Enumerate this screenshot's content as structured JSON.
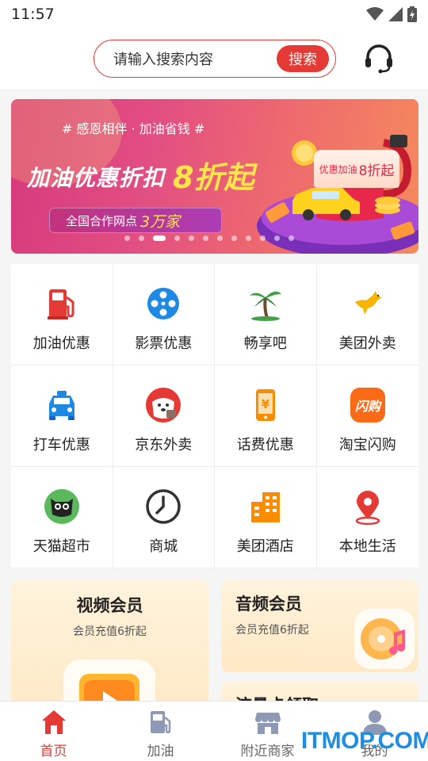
{
  "status": {
    "time": "11:57"
  },
  "search": {
    "placeholder": "请输入搜索内容",
    "button": "搜索"
  },
  "header": {
    "support_icon": "headset-icon"
  },
  "banner": {
    "tagline": "# 感恩相伴 · 加油省钱 #",
    "headline": "加油优惠折扣",
    "discount": "8折起",
    "pill_text": "全国合作网点",
    "pill_number": "3万家",
    "sign_text": "优惠加油",
    "sign_big": "8折起",
    "dots_total": 12,
    "dots_active": 2
  },
  "grid": {
    "items": [
      {
        "label": "加油优惠",
        "icon": "fuel-pump-icon",
        "color": "#e53935"
      },
      {
        "label": "影票优惠",
        "icon": "film-reel-icon",
        "color": "#1e88e5"
      },
      {
        "label": "畅享吧",
        "icon": "palm-tree-icon",
        "color": "#43a047"
      },
      {
        "label": "美团外卖",
        "icon": "kangaroo-icon",
        "color": "#f7b500"
      },
      {
        "label": "打车优惠",
        "icon": "taxi-icon",
        "color": "#1e88e5"
      },
      {
        "label": "京东外卖",
        "icon": "jd-dog-icon",
        "color": "#e53935"
      },
      {
        "label": "话费优惠",
        "icon": "phone-bill-icon",
        "color": "#fb8c00"
      },
      {
        "label": "淘宝闪购",
        "icon": "flash-buy-icon",
        "color": "#fb6a17"
      },
      {
        "label": "天猫超市",
        "icon": "tmall-cat-icon",
        "color": "#5cb85c"
      },
      {
        "label": "商城",
        "icon": "clock-icon",
        "color": "#333333"
      },
      {
        "label": "美团酒店",
        "icon": "hotel-building-icon",
        "color": "#fb8c00"
      },
      {
        "label": "本地生活",
        "icon": "location-pin-icon",
        "color": "#e53935"
      }
    ]
  },
  "cards": {
    "video": {
      "title": "视频会员",
      "sub": "会员充值6折起"
    },
    "audio": {
      "title": "音频会员",
      "sub": "会员充值6折起"
    },
    "flow": {
      "title": "流量卡领取"
    }
  },
  "tabbar": {
    "items": [
      {
        "label": "首页",
        "icon": "home-icon",
        "active": true
      },
      {
        "label": "加油",
        "icon": "gas-station-icon",
        "active": false
      },
      {
        "label": "附近商家",
        "icon": "storefront-icon",
        "active": false
      },
      {
        "label": "我的",
        "icon": "user-icon",
        "active": false
      }
    ]
  },
  "watermark": {
    "text": "ITMOP.COM"
  },
  "colors": {
    "primary": "#e53935",
    "banner_start": "#d6397c",
    "banner_end": "#f58a5c",
    "card_bg": "#ffefd3"
  }
}
